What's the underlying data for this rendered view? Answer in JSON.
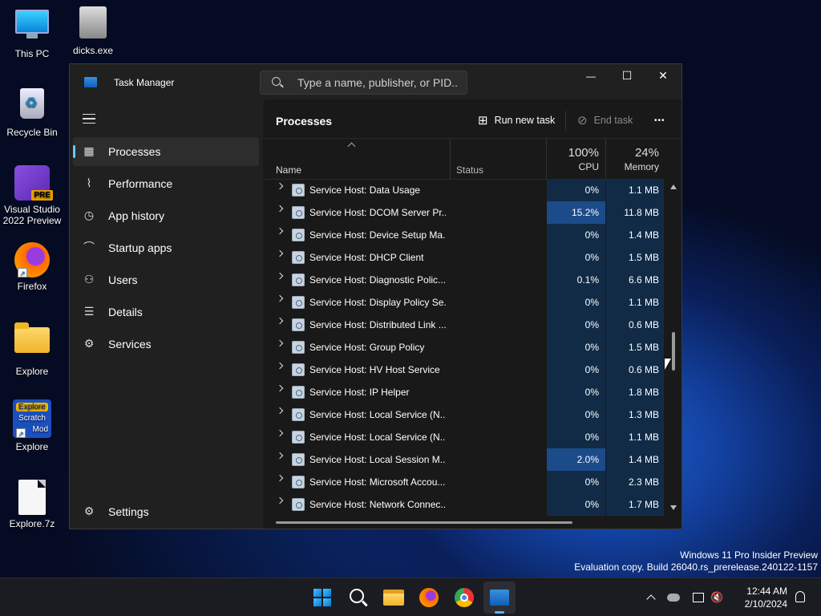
{
  "desktop": {
    "icons": [
      {
        "label": "This PC",
        "icon": "monitor-icon"
      },
      {
        "label": "dicks.exe",
        "icon": "exe-icon"
      },
      {
        "label": "Recycle Bin",
        "icon": "recycle-bin-icon"
      },
      {
        "label": "Visual Studio 2022 Preview",
        "badge": "PRE",
        "icon": "visual-studio-icon"
      },
      {
        "label": "Firefox",
        "icon": "firefox-icon"
      },
      {
        "label": "Explore",
        "icon": "folder-icon"
      },
      {
        "label": "Explore",
        "icon": "scratch-mod-icon",
        "art1": "Explore",
        "art2": "Scratch",
        "art3": "Mod"
      },
      {
        "label": "Explore.7z",
        "icon": "file-icon"
      }
    ],
    "watermark": {
      "line1": "Windows 11 Pro Insider Preview",
      "line2": "Evaluation copy. Build 26040.rs_prerelease.240122-1157"
    }
  },
  "window": {
    "title": "Task Manager",
    "search_placeholder": "Type a name, publisher, or PID...",
    "controls": {
      "minimize": "—",
      "maximize": "☐",
      "close": "✕"
    }
  },
  "sidebar": {
    "items": [
      {
        "label": "Processes",
        "icon": "processes-icon",
        "selected": true
      },
      {
        "label": "Performance",
        "icon": "performance-icon"
      },
      {
        "label": "App history",
        "icon": "app-history-icon"
      },
      {
        "label": "Startup apps",
        "icon": "startup-apps-icon"
      },
      {
        "label": "Users",
        "icon": "users-icon"
      },
      {
        "label": "Details",
        "icon": "details-icon"
      },
      {
        "label": "Services",
        "icon": "services-icon"
      }
    ],
    "settings": "Settings"
  },
  "main": {
    "title": "Processes",
    "run_new_task": "Run new task",
    "end_task": "End task",
    "more": "•••",
    "columns": {
      "name": "Name",
      "status": "Status",
      "cpu_pct": "100%",
      "cpu": "CPU",
      "mem_pct": "24%",
      "memory": "Memory"
    },
    "rows": [
      {
        "name": "Service Host: Data Usage",
        "cpu": "0%",
        "mem": "1.1 MB"
      },
      {
        "name": "Service Host: DCOM Server Pr...",
        "cpu": "15.2%",
        "mem": "11.8 MB",
        "hot": true
      },
      {
        "name": "Service Host: Device Setup Ma...",
        "cpu": "0%",
        "mem": "1.4 MB"
      },
      {
        "name": "Service Host: DHCP Client",
        "cpu": "0%",
        "mem": "1.5 MB"
      },
      {
        "name": "Service Host: Diagnostic Polic...",
        "cpu": "0.1%",
        "mem": "6.6 MB"
      },
      {
        "name": "Service Host: Display Policy Se...",
        "cpu": "0%",
        "mem": "1.1 MB"
      },
      {
        "name": "Service Host: Distributed Link ...",
        "cpu": "0%",
        "mem": "0.6 MB"
      },
      {
        "name": "Service Host: Group Policy",
        "cpu": "0%",
        "mem": "1.5 MB"
      },
      {
        "name": "Service Host: HV Host Service",
        "cpu": "0%",
        "mem": "0.6 MB"
      },
      {
        "name": "Service Host: IP Helper",
        "cpu": "0%",
        "mem": "1.8 MB"
      },
      {
        "name": "Service Host: Local Service (N...",
        "cpu": "0%",
        "mem": "1.3 MB"
      },
      {
        "name": "Service Host: Local Service (N...",
        "cpu": "0%",
        "mem": "1.1 MB"
      },
      {
        "name": "Service Host: Local Session M...",
        "cpu": "2.0%",
        "mem": "1.4 MB",
        "hot": true
      },
      {
        "name": "Service Host: Microsoft Accou...",
        "cpu": "0%",
        "mem": "2.3 MB"
      },
      {
        "name": "Service Host: Network Connec...",
        "cpu": "0%",
        "mem": "1.7 MB"
      }
    ]
  },
  "taskbar": {
    "apps": [
      {
        "icon": "start-icon"
      },
      {
        "icon": "search-icon"
      },
      {
        "icon": "file-explorer-icon"
      },
      {
        "icon": "firefox-icon"
      },
      {
        "icon": "chrome-icon"
      },
      {
        "icon": "task-manager-icon",
        "active": true
      }
    ],
    "time": "12:44 AM",
    "date": "2/10/2024"
  }
}
